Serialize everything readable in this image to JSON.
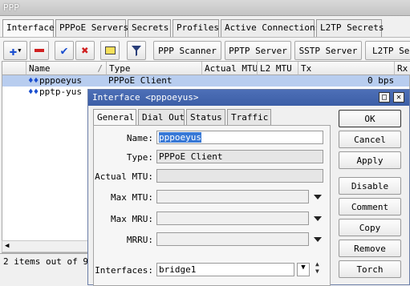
{
  "window": {
    "title": "PPP"
  },
  "tabs": [
    {
      "label": "Interface"
    },
    {
      "label": "PPPoE Servers"
    },
    {
      "label": "Secrets"
    },
    {
      "label": "Profiles"
    },
    {
      "label": "Active Connections"
    },
    {
      "label": "L2TP Secrets"
    }
  ],
  "toolbar": {
    "ppp_scanner": "PPP Scanner",
    "pptp_server": "PPTP Server",
    "sstp_server": "SSTP Server",
    "l2tp_server": "L2TP Ser"
  },
  "table": {
    "headers": [
      "Name",
      "/",
      "Type",
      "Actual MTU",
      "L2 MTU",
      "Tx",
      "Rx"
    ],
    "rows": [
      {
        "flags": "♦♦",
        "name": "pppoeyus",
        "type": "PPPoE Client",
        "tx": "0 bps"
      },
      {
        "flags": "♦♦",
        "name": "pptp-yus",
        "type": "",
        "tx": ""
      }
    ]
  },
  "status": {
    "items_text": "2 items out of 9"
  },
  "dialog": {
    "title": "Interface <pppoeyus>",
    "tabs": [
      "General",
      "Dial Out",
      "Status",
      "Traffic"
    ],
    "fields": {
      "name_label": "Name:",
      "name_value": "pppoeyus",
      "type_label": "Type:",
      "type_value": "PPPoE Client",
      "actual_mtu_label": "Actual MTU:",
      "max_mtu_label": "Max MTU:",
      "max_mru_label": "Max MRU:",
      "mrru_label": "MRRU:",
      "interfaces_label": "Interfaces:",
      "interfaces_value": "bridge1"
    },
    "buttons": [
      "OK",
      "Cancel",
      "Apply",
      "Disable",
      "Comment",
      "Copy",
      "Remove",
      "Torch"
    ]
  },
  "colors": {
    "selection": "#b8cdef",
    "dialog_title": "#4d6fb7",
    "accent_blue": "#1b4fcf",
    "remove_red": "#d02020"
  }
}
